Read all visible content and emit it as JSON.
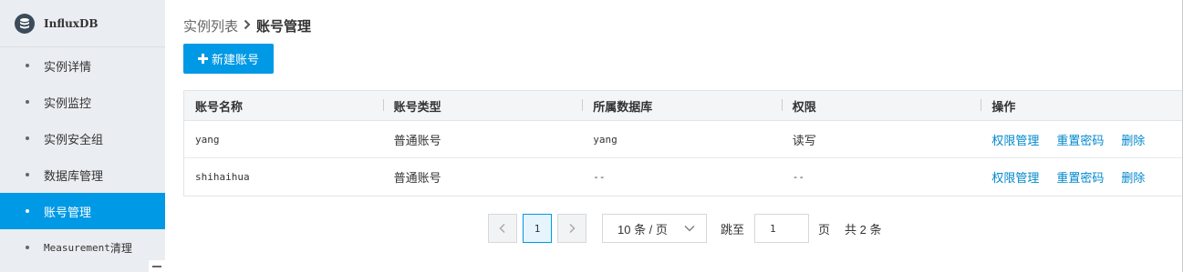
{
  "sidebar": {
    "brand": "InfluxDB",
    "items": [
      {
        "label": "实例详情",
        "active": false
      },
      {
        "label": "实例监控",
        "active": false
      },
      {
        "label": "实例安全组",
        "active": false
      },
      {
        "label": "数据库管理",
        "active": false
      },
      {
        "label": "账号管理",
        "active": true
      }
    ],
    "measurement_item": {
      "prefix": "Measurement",
      "suffix": "清理"
    }
  },
  "breadcrumb": {
    "parent": "实例列表",
    "current": "账号管理"
  },
  "toolbar": {
    "new_account_label": "新建账号"
  },
  "table": {
    "columns": [
      "账号名称",
      "账号类型",
      "所属数据库",
      "权限",
      "操作"
    ],
    "rows": [
      {
        "name": "yang",
        "type": "普通账号",
        "database": "yang",
        "permission": "读写"
      },
      {
        "name": "shihaihua",
        "type": "普通账号",
        "database": "--",
        "permission": "--"
      }
    ],
    "actions": {
      "manage_permissions": "权限管理",
      "reset_password": "重置密码",
      "delete": "删除"
    }
  },
  "pagination": {
    "current_page": "1",
    "page_size": "10 条 / 页",
    "goto_label": "跳至",
    "goto_value": "1",
    "page_unit": "页",
    "total": "共 2 条"
  },
  "colors": {
    "accent": "#0099e5",
    "link": "#0088cc",
    "sidebar_bg": "#eaedf1"
  }
}
